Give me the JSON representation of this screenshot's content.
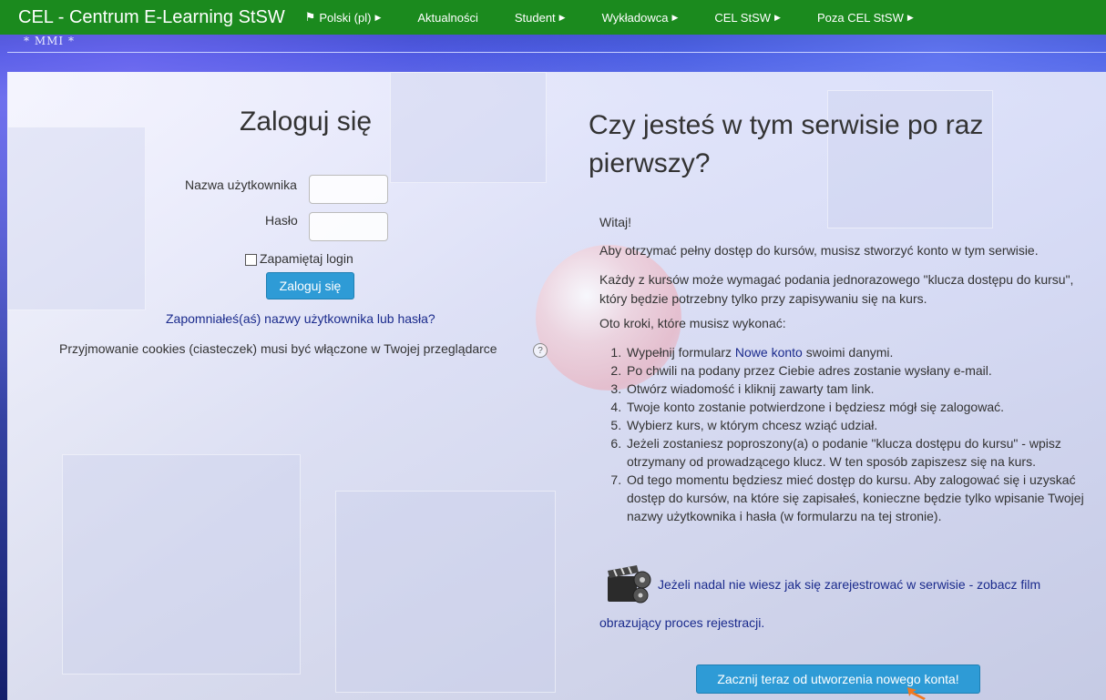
{
  "topbar": {
    "brand": "CEL - Centrum E-Learning StSW",
    "nav": [
      {
        "label": "Polski (pl)",
        "icon": "flag-icon",
        "has_caret": true
      },
      {
        "label": "Aktualności",
        "has_caret": false
      },
      {
        "label": "Student",
        "has_caret": true
      },
      {
        "label": "Wykładowca",
        "has_caret": true
      },
      {
        "label": "CEL StSW",
        "has_caret": true
      },
      {
        "label": "Poza CEL StSW",
        "has_caret": true
      }
    ],
    "bg_color": "#1b8a1e"
  },
  "mmi": "* MMI *",
  "login": {
    "title": "Zaloguj się",
    "username_label": "Nazwa użytkownika",
    "password_label": "Hasło",
    "remember_label": "Zapamiętaj login",
    "submit_label": "Zaloguj się",
    "forgot_link": "Zapomniałeś(aś) nazwy użytkownika lub hasła?",
    "cookies_text": "Przyjmowanie cookies (ciasteczek) musi być włączone w Twojej przeglądarce"
  },
  "signup": {
    "title": "Czy jesteś w tym serwisie po raz pierwszy?",
    "greeting": "Witaj!",
    "para1": "Aby otrzymać pełny dostęp do kursów, musisz stworzyć konto w tym serwisie.",
    "para2": "Każdy z kursów może wymagać podania jednorazowego \"klucza dostępu do kursu\", który będzie potrzebny tylko przy zapisywaniu się na kurs.",
    "para3": "Oto kroki, które musisz wykonać:",
    "step1_pre": "Wypełnij formularz ",
    "step1_link": "Nowe konto",
    "step1_post": " swoimi danymi.",
    "step2": "Po chwili na podany przez Ciebie adres zostanie wysłany e-mail.",
    "step3": "Otwórz wiadomość i kliknij zawarty tam link.",
    "step4": "Twoje konto zostanie potwierdzone i będziesz mógł się zalogować.",
    "step5": "Wybierz kurs, w którym chcesz wziąć udział.",
    "step6": "Jeżeli zostaniesz poproszony(a) o podanie \"klucza dostępu do kursu\" - wpisz otrzymany od prowadzącego klucz. W ten sposób zapiszesz się na kurs.",
    "step7": "Od tego momentu będziesz mieć dostęp do kursu. Aby zalogować się i uzyskać dostęp do kursów, na które się zapisałeś, konieczne będzie tylko wpisanie Twojej nazwy użytkownika i hasła (w formularzu na tej stronie).",
    "film_link_part1": "Jeżeli nadal nie wiesz jak się zarejestrować w serwisie - zobacz film",
    "film_link_part2": "obrazujący proces rejestracji.",
    "button": "Zacznij teraz od utworzenia nowego konta!"
  }
}
